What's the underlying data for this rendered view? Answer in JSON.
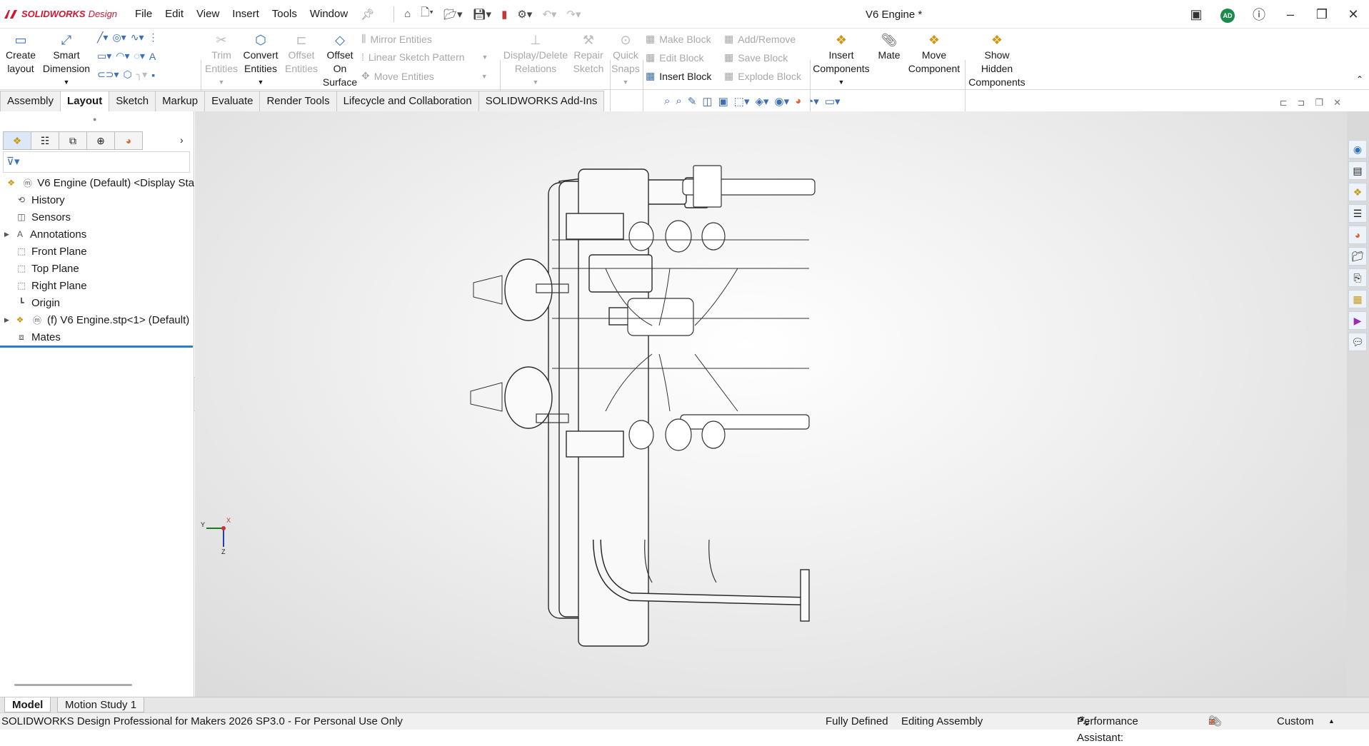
{
  "app": {
    "brand_bold": "SOLIDWORKS",
    "brand_light": "Design",
    "document_title": "V6 Engine *",
    "avatar_initials": "AD"
  },
  "menu": [
    "File",
    "Edit",
    "View",
    "Insert",
    "Tools",
    "Window"
  ],
  "ribbon": {
    "create_layout": [
      "Create",
      "layout"
    ],
    "smart_dimension": [
      "Smart",
      "Dimension"
    ],
    "trim_entities": [
      "Trim",
      "Entities"
    ],
    "convert_entities": [
      "Convert",
      "Entities"
    ],
    "offset_entities": [
      "Offset",
      "Entities"
    ],
    "offset_on_surface": [
      "Offset",
      "On",
      "Surface"
    ],
    "mirror_entities": "Mirror Entities",
    "linear_sketch_pattern": "Linear Sketch Pattern",
    "move_entities": "Move Entities",
    "display_delete_relations": [
      "Display/Delete",
      "Relations"
    ],
    "repair_sketch": [
      "Repair",
      "Sketch"
    ],
    "quick_snaps": [
      "Quick",
      "Snaps"
    ],
    "make_block": "Make Block",
    "edit_block": "Edit Block",
    "insert_block": "Insert Block",
    "add_remove": "Add/Remove",
    "save_block": "Save Block",
    "explode_block": "Explode Block",
    "insert_components": [
      "Insert",
      "Components"
    ],
    "mate": "Mate",
    "move_component": [
      "Move",
      "Component"
    ],
    "show_hidden_components": [
      "Show",
      "Hidden",
      "Components"
    ]
  },
  "tabs": [
    "Assembly",
    "Layout",
    "Sketch",
    "Markup",
    "Evaluate",
    "Render Tools",
    "Lifecycle and Collaboration",
    "SOLIDWORKS Add-Ins"
  ],
  "tree": [
    {
      "label": "V6 Engine (Default) <Display Sta"
    },
    {
      "label": "History"
    },
    {
      "label": "Sensors"
    },
    {
      "label": "Annotations"
    },
    {
      "label": "Front Plane"
    },
    {
      "label": "Top Plane"
    },
    {
      "label": "Right Plane"
    },
    {
      "label": "Origin"
    },
    {
      "label": "(f) V6 Engine.stp<1> (Default)"
    },
    {
      "label": "Mates"
    }
  ],
  "triad": {
    "x": "X",
    "y": "Y",
    "z": "Z"
  },
  "bottom_tabs": [
    "Model",
    "Motion Study 1"
  ],
  "status": {
    "product": "SOLIDWORKS Design Professional for Makers 2026 SP3.0 - For Personal Use Only",
    "state": "Fully Defined",
    "mode": "Editing Assembly",
    "performance": "Performance Assistant:",
    "units": "Custom"
  }
}
